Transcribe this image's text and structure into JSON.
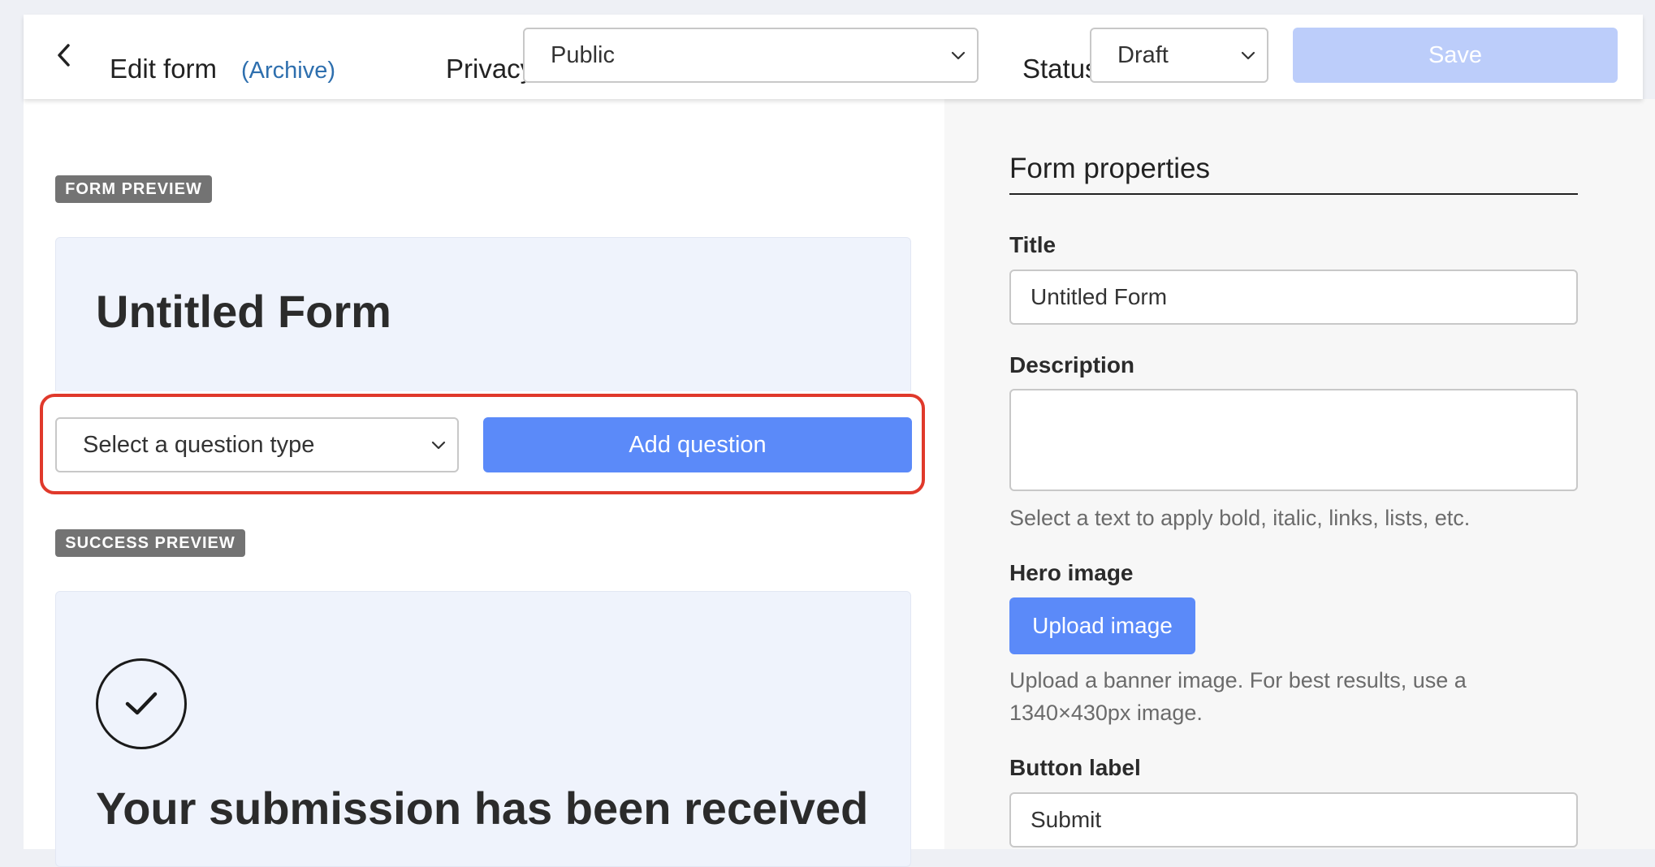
{
  "header": {
    "back_icon": "chevron-left-icon",
    "title": "Edit form",
    "archive_label": "(Archive)",
    "privacy_label": "Privacy",
    "privacy_value": "Public",
    "status_label": "Status",
    "status_value": "Draft",
    "save_label": "Save"
  },
  "form_preview": {
    "badge": "FORM PREVIEW",
    "title": "Untitled Form",
    "question_type_placeholder": "Select a question type",
    "add_question_label": "Add question"
  },
  "success_preview": {
    "badge": "SUCCESS PREVIEW",
    "icon": "check-circle-icon",
    "message": "Your submission has been received"
  },
  "properties": {
    "heading": "Form properties",
    "title_label": "Title",
    "title_value": "Untitled Form",
    "description_label": "Description",
    "description_value": "",
    "description_hint": "Select a text to apply bold, italic, links, lists, etc.",
    "hero_label": "Hero image",
    "upload_label": "Upload image",
    "hero_hint_line1": "Upload a banner image. For best results, use a",
    "hero_hint_line2": "1340×430px image.",
    "button_label_label": "Button label",
    "button_label_value": "Submit"
  },
  "colors": {
    "accent": "#5b8af9",
    "save_disabled": "#bccdfa",
    "highlight": "#e0392b",
    "link": "#2e6fae",
    "card_bg": "#eff3fc"
  }
}
